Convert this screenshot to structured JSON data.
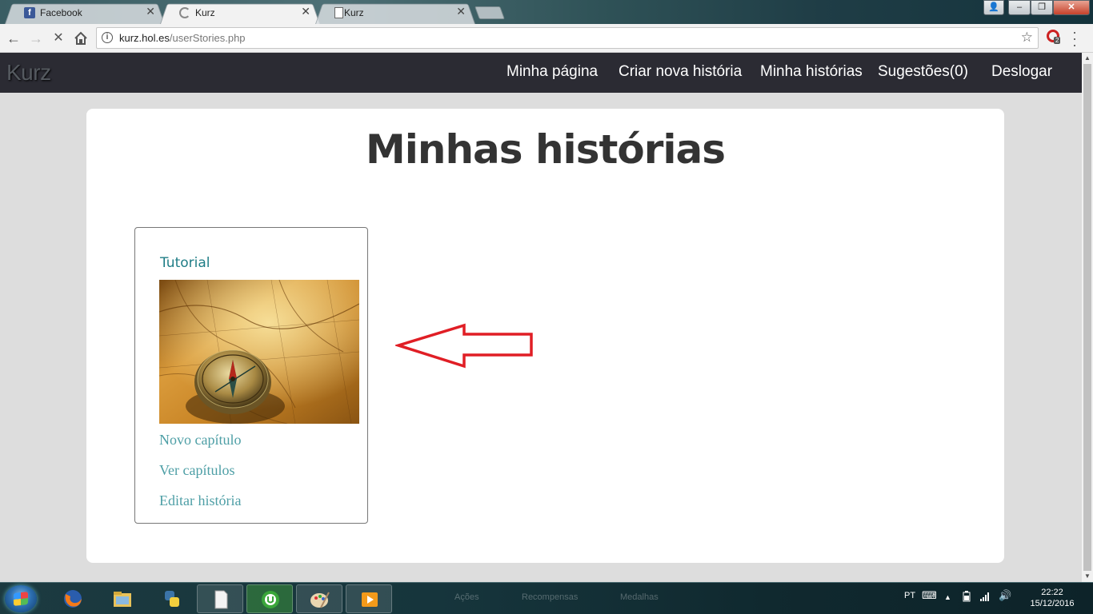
{
  "browser": {
    "tabs": [
      {
        "title": "Facebook",
        "icon": "facebook-icon",
        "active": false
      },
      {
        "title": "Kurz",
        "icon": "loading-spinner-icon",
        "active": true
      },
      {
        "title": "Kurz",
        "icon": "page-icon",
        "active": false
      }
    ],
    "close_glyph": "✕",
    "url_host": "kurz.hol.es",
    "url_path": "/userStories.php",
    "extension_badge": "2",
    "window_controls": {
      "minimize": "–",
      "maximize": "❐",
      "close": "✕"
    }
  },
  "site": {
    "brand": "Kurz",
    "nav": [
      "Minha página",
      "Criar nova história",
      "Minha histórias",
      "Sugestões(0)",
      "Deslogar"
    ]
  },
  "page": {
    "title": "Minhas histórias",
    "stories": [
      {
        "title": "Tutorial",
        "cover": "compass-on-map-image",
        "actions": [
          "Novo capítulo",
          "Ver capítulos",
          "Editar história"
        ]
      }
    ],
    "annotation": {
      "shape": "red-outline-arrow",
      "color": "#e01e25",
      "points_to": "story-card"
    }
  },
  "colors": {
    "navbar": "#2b2b33",
    "story_title": "#1f7d86",
    "links": "#4e9fa6",
    "background": "#dddddd"
  },
  "taskbar": {
    "apps": [
      "firefox-icon",
      "file-explorer-icon",
      "python-icon",
      "blank-document-icon",
      "utorrent-icon",
      "paint-icon",
      "media-player-icon"
    ],
    "ghost_labels": [
      "Ações",
      "Recompensas",
      "Medalhas"
    ],
    "language": "PT",
    "time": "22:22",
    "date": "15/12/2016"
  }
}
